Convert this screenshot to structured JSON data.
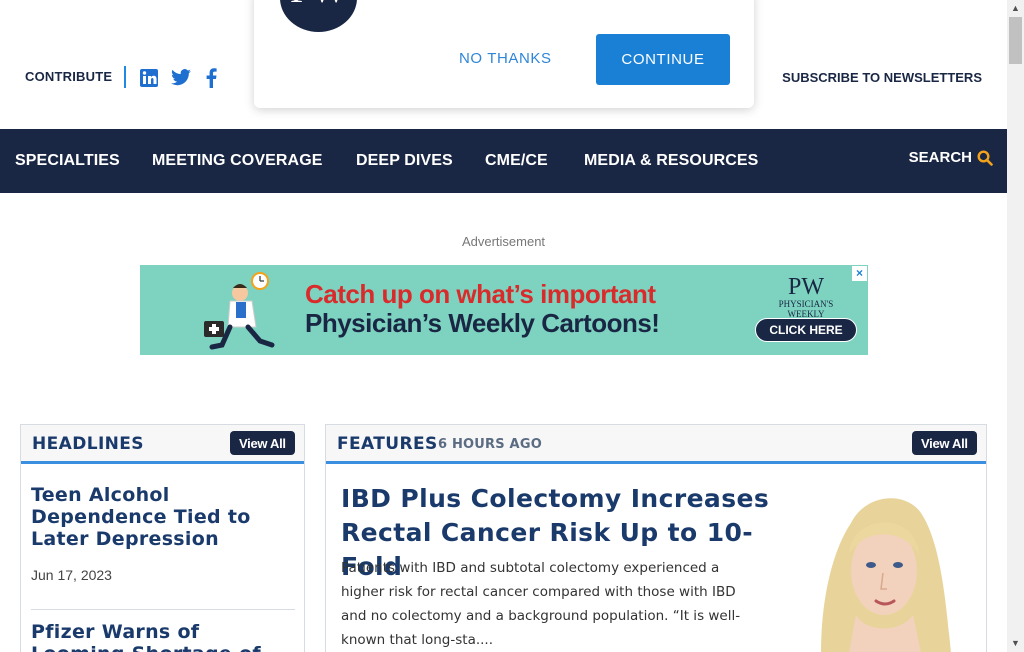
{
  "topbar": {
    "contribute_label": "CONTRIBUTE",
    "social": [
      "linkedin-icon",
      "twitter-icon",
      "facebook-icon"
    ],
    "subscribe_label": "SUBSCRIBE TO NEWSLETTERS"
  },
  "popup": {
    "logo_text": "PW",
    "no_thanks_label": "NO THANKS",
    "continue_label": "CONTINUE"
  },
  "nav": {
    "items": [
      "SPECIALTIES",
      "MEETING COVERAGE",
      "DEEP DIVES",
      "CME/CE",
      "MEDIA & RESOURCES"
    ],
    "search_label": "SEARCH"
  },
  "ad": {
    "label": "Advertisement",
    "line1": "Catch up on what’s important",
    "line2": "Physician’s Weekly Cartoons!",
    "brand_logo": "PW",
    "brand_name": "PHYSICIAN'S WEEKLY",
    "cta_label": "CLICK HERE",
    "close_label": "×"
  },
  "headlines": {
    "title": "HEADLINES",
    "view_all_label": "View All",
    "items": [
      {
        "title": "Teen Alcohol Dependence Tied to Later Depression",
        "date": "Jun 17, 2023"
      },
      {
        "title": "Pfizer Warns of Looming Shortage of",
        "date": ""
      }
    ]
  },
  "features": {
    "title": "FEATURES",
    "time_ago": "6 HOURS AGO",
    "view_all_label": "View All",
    "article_title": "IBD Plus Colectomy Increases Rectal Cancer Risk Up to 10-Fold",
    "article_excerpt": "Patients with IBD and subtotal colectomy experienced a higher risk for rectal cancer compared with those with IBD and no colectomy and a background population. “It is well-known that long-sta...."
  },
  "colors": {
    "navy": "#1a2744",
    "accent_blue": "#1a80d6",
    "search_icon": "#f2a31b",
    "ad_bg": "#7dd3bf"
  }
}
